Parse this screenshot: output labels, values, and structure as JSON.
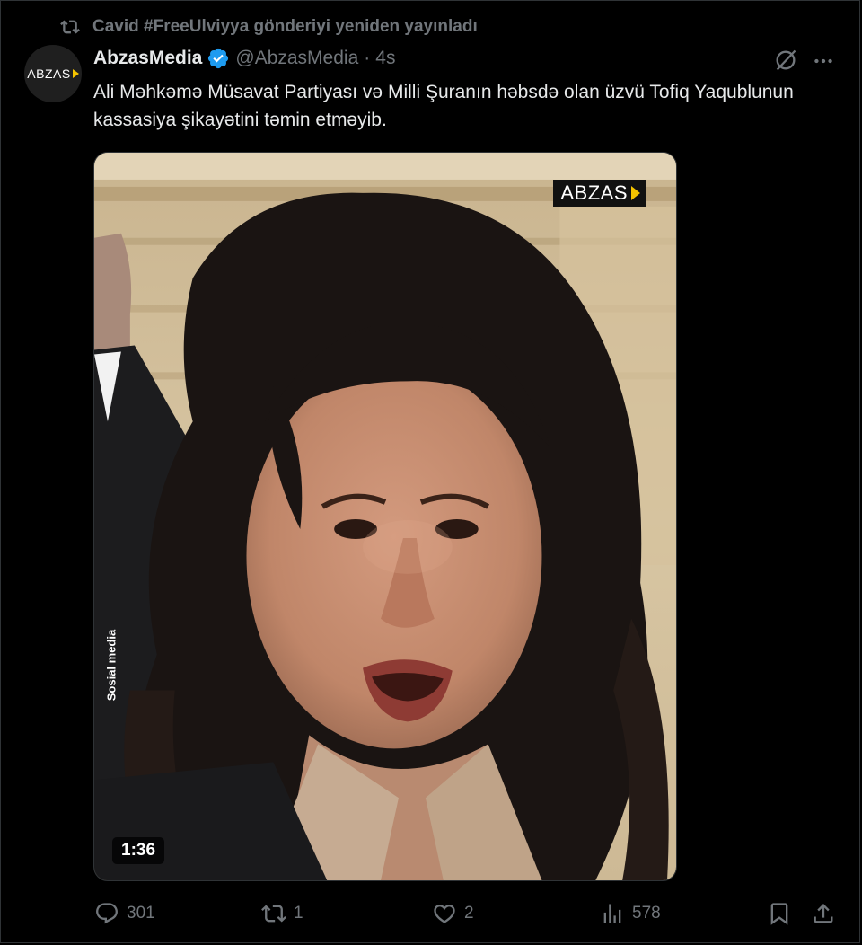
{
  "retweet_context": {
    "text": "Cavid #FreeUlviyya gönderiyi yeniden yayınladı",
    "icon": "retweet-icon"
  },
  "author": {
    "display_name": "AbzasMedia",
    "handle": "@AbzasMedia",
    "separator": "·",
    "time": "4s",
    "avatar_logo_text": "ABZAS",
    "verified_color": "#1d9bf0"
  },
  "tweet": {
    "text": "Ali Məhkəmə Müsavat Partiyası və Milli Şuranın həbsdə olan üzvü Tofiq Yaqublunun kassasiya şikayətini təmin etməyib."
  },
  "media": {
    "watermark": "ABZAS",
    "side_credit": "Sosial media",
    "duration": "1:36",
    "accent_color": "#f5c400"
  },
  "actions": {
    "reply_count": "301",
    "retweet_count": "1",
    "like_count": "2",
    "views_count": "578"
  }
}
